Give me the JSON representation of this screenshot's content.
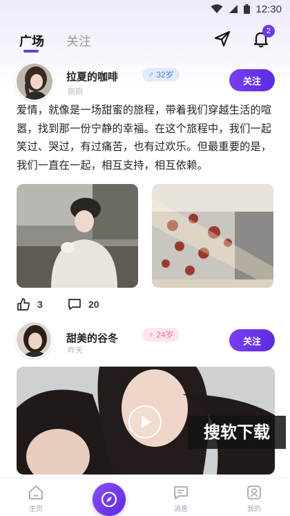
{
  "status_bar": {
    "time": "12:30"
  },
  "tabs": [
    {
      "label": "广场",
      "active": true
    },
    {
      "label": "关注",
      "active": false
    }
  ],
  "notifications": {
    "count": "2"
  },
  "posts": [
    {
      "username": "拉夏的咖啡",
      "gender": "male",
      "gender_symbol": "♂",
      "age": "32岁",
      "time": "刚刚",
      "follow_label": "关注",
      "text": "爱情，就像是一场甜蜜的旅程，带着我们穿越生活的喧嚣，找到那一份宁静的幸福。在这个旅程中，我们一起笑过、哭过，有过痛苦，也有过欢乐。但最重要的是，我们一直在一起，相互支持，相互依赖。",
      "likes": "3",
      "comments": "20"
    },
    {
      "username": "甜美的谷冬",
      "gender": "female",
      "gender_symbol": "♀",
      "age": "24岁",
      "time": "昨天",
      "follow_label": "关注"
    }
  ],
  "watermark": "搜软下载",
  "bottom_nav": [
    {
      "label": "主页"
    },
    {
      "label": ""
    },
    {
      "label": "消息"
    },
    {
      "label": "我的"
    }
  ],
  "colors": {
    "accent": "#6a3ce8",
    "male": "#4d82e6",
    "female": "#ef6f97"
  }
}
